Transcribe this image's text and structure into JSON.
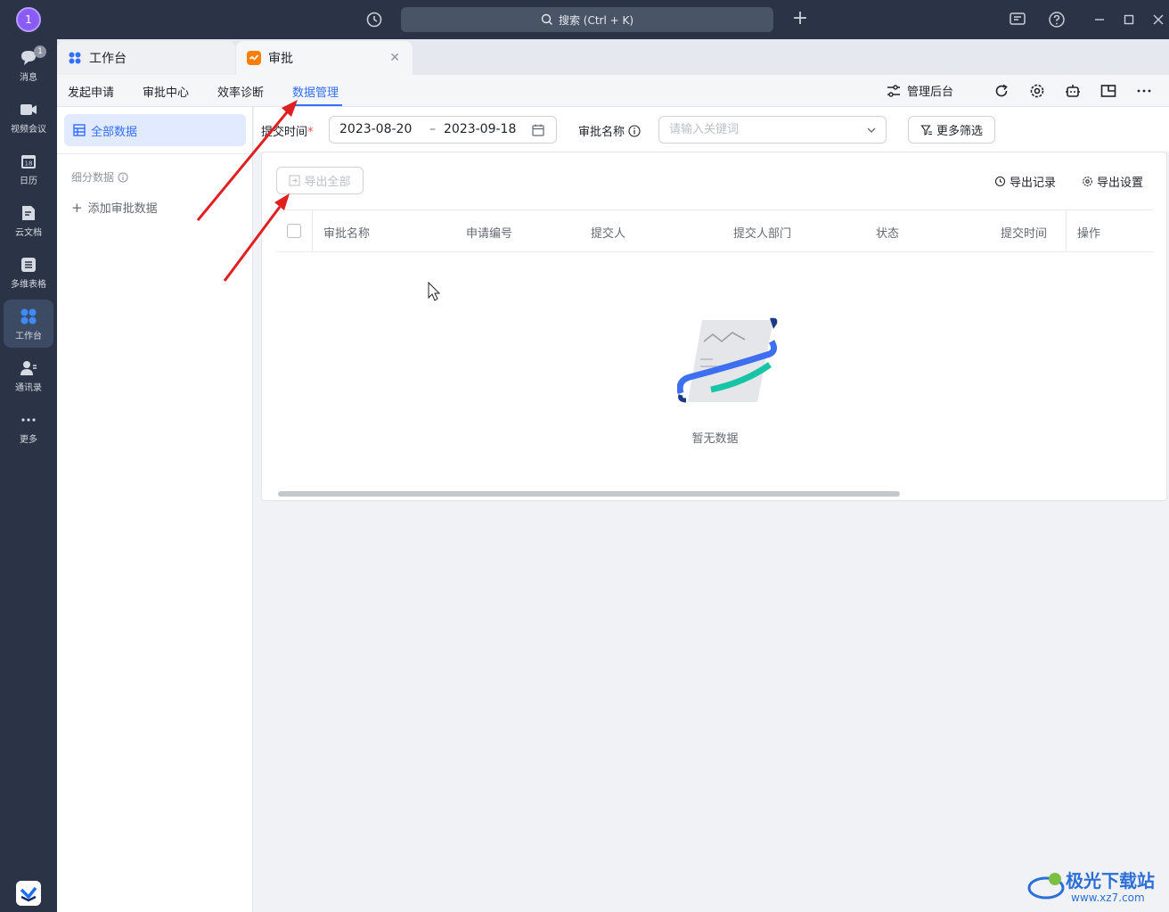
{
  "titlebar": {
    "avatar": "1",
    "search_text": "搜索 (Ctrl + K)"
  },
  "rail": {
    "items": [
      {
        "label": "消息",
        "badge": "1"
      },
      {
        "label": "视频会议"
      },
      {
        "label": "日历"
      },
      {
        "label": "云文档"
      },
      {
        "label": "多维表格"
      },
      {
        "label": "工作台"
      },
      {
        "label": "通讯录"
      },
      {
        "label": "更多"
      }
    ],
    "user_badge": "1"
  },
  "window_tabs": [
    {
      "label": "工作台"
    },
    {
      "label": "审批"
    }
  ],
  "subnav": {
    "items": [
      "发起申请",
      "审批中心",
      "效率诊断",
      "数据管理"
    ],
    "active": "数据管理",
    "admin_label": "管理后台"
  },
  "left_panel": {
    "all_data": "全部数据",
    "sub_heading": "细分数据",
    "add_label": "添加审批数据"
  },
  "filters": {
    "time_label": "提交时间",
    "required_mark": "*",
    "date_start": "2023-08-20",
    "date_sep": "–",
    "date_end": "2023-09-18",
    "name_label": "审批名称",
    "keyword_placeholder": "请输入关键词",
    "more_filter": "更多筛选"
  },
  "card": {
    "export_all": "导出全部",
    "export_record": "导出记录",
    "export_settings": "导出设置",
    "columns": [
      "审批名称",
      "申请编号",
      "提交人",
      "提交人部门",
      "状态",
      "提交时间",
      "操作"
    ],
    "empty_text": "暂无数据"
  },
  "watermark": {
    "brand": "极光下载站",
    "url": "www.xz7.com"
  },
  "colors": {
    "accent": "#3370ff",
    "annotation": "#e02020"
  }
}
